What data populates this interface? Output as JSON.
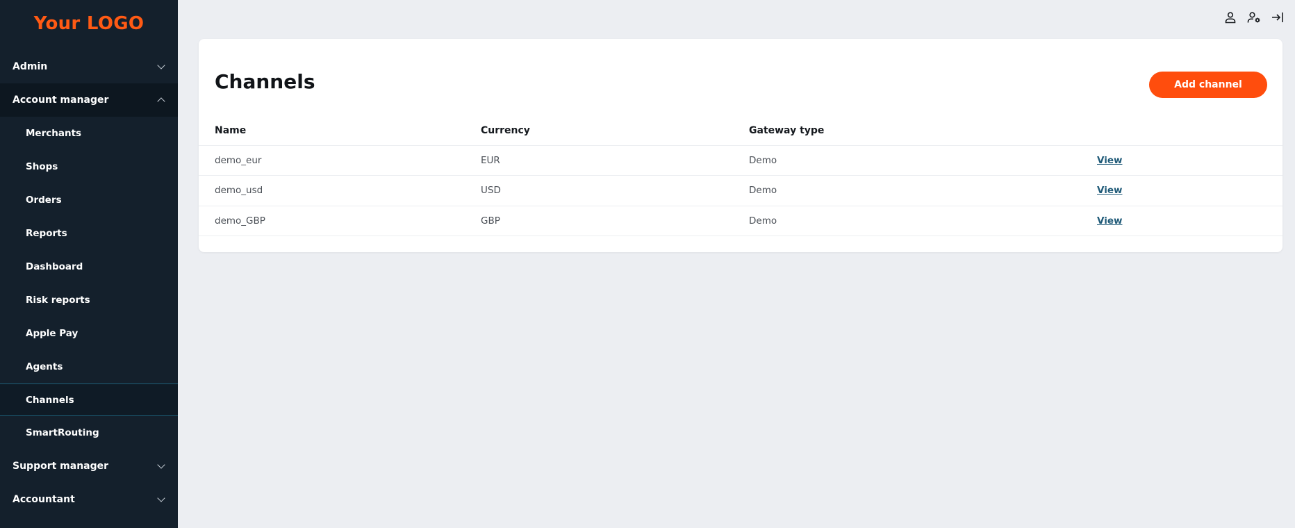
{
  "logo": "Your LOGO",
  "sidebar": {
    "groups": [
      {
        "label": "Admin"
      },
      {
        "label": "Account manager"
      }
    ],
    "items": [
      {
        "label": "Merchants"
      },
      {
        "label": "Shops"
      },
      {
        "label": "Orders"
      },
      {
        "label": "Reports"
      },
      {
        "label": "Dashboard"
      },
      {
        "label": "Risk reports"
      },
      {
        "label": "Apple Pay"
      },
      {
        "label": "Agents"
      },
      {
        "label": "Channels"
      },
      {
        "label": "SmartRouting"
      }
    ],
    "bottom_groups": [
      {
        "label": "Support manager"
      },
      {
        "label": "Accountant"
      }
    ]
  },
  "topbar": {
    "icons": [
      "user-icon",
      "user-settings-icon",
      "logout-icon"
    ]
  },
  "main": {
    "title": "Channels",
    "add_button": "Add channel",
    "table": {
      "headers": [
        "Name",
        "Currency",
        "Gateway type",
        ""
      ],
      "rows": [
        {
          "name": "demo_eur",
          "currency": "EUR",
          "gateway": "Demo",
          "action": "View"
        },
        {
          "name": "demo_usd",
          "currency": "USD",
          "gateway": "Demo",
          "action": "View"
        },
        {
          "name": "demo_GBP",
          "currency": "GBP",
          "gateway": "Demo",
          "action": "View"
        }
      ]
    }
  },
  "colors": {
    "accent": "#ff4d0d",
    "sidebar_bg": "#14202c",
    "link": "#1f5a78"
  }
}
